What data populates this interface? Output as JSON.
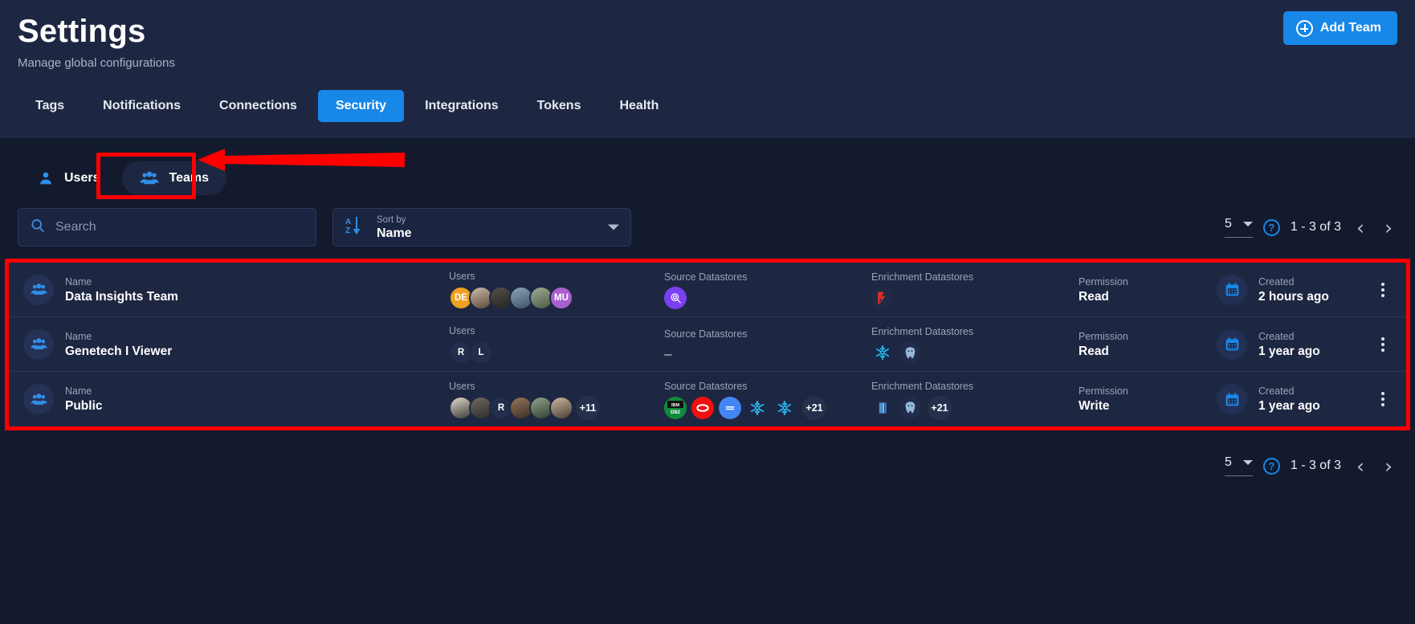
{
  "header": {
    "title": "Settings",
    "subtitle": "Manage global configurations",
    "add_team_label": "Add Team",
    "tabs": [
      {
        "label": "Tags",
        "active": false
      },
      {
        "label": "Notifications",
        "active": false
      },
      {
        "label": "Connections",
        "active": false
      },
      {
        "label": "Security",
        "active": true
      },
      {
        "label": "Integrations",
        "active": false
      },
      {
        "label": "Tokens",
        "active": false
      },
      {
        "label": "Health",
        "active": false
      }
    ]
  },
  "subnav": [
    {
      "label": "Users",
      "icon": "user-icon",
      "active": false
    },
    {
      "label": "Teams",
      "icon": "users-group-icon",
      "active": true
    }
  ],
  "filters": {
    "search_placeholder": "Search",
    "search_value": "",
    "sort_caption": "Sort by",
    "sort_value": "Name"
  },
  "pagination": {
    "page_size": "5",
    "range": "1 - 3 of 3",
    "prev_label": "‹",
    "next_label": "›"
  },
  "columns": {
    "name": "Name",
    "users": "Users",
    "source_datastores": "Source Datastores",
    "enrichment_datastores": "Enrichment Datastores",
    "permission": "Permission",
    "created": "Created"
  },
  "colors": {
    "accent": "#1787e8",
    "annotation": "#ff0000",
    "panel": "#1e2742",
    "background": "#131a2e"
  },
  "rows": [
    {
      "name": "Data Insights Team",
      "users": [
        {
          "type": "initials",
          "text": "DE",
          "color": "#f0a020"
        },
        {
          "type": "photo",
          "color": "#c9b6a4"
        },
        {
          "type": "photo",
          "color": "#3b3a38"
        },
        {
          "type": "photo",
          "color": "#6f8aa0"
        },
        {
          "type": "photo",
          "color": "#8a9c8e"
        },
        {
          "type": "initials",
          "text": "MU",
          "color": "#a95fd0"
        }
      ],
      "users_more": "",
      "source": [
        {
          "type": "icon",
          "name": "datastore-purple-icon",
          "color": "#7b3ff2"
        }
      ],
      "source_more": "",
      "source_empty": false,
      "enrichment": [
        {
          "type": "icon",
          "name": "datastore-red-icon",
          "color": "#e02b20"
        }
      ],
      "enrichment_more": "",
      "permission": "Read",
      "created": "2 hours ago"
    },
    {
      "name": "Genetech I Viewer",
      "users": [
        {
          "type": "initials",
          "text": "R",
          "color": "#232d4c"
        },
        {
          "type": "initials",
          "text": "L",
          "color": "#232d4c"
        }
      ],
      "users_more": "",
      "source": [],
      "source_more": "",
      "source_empty": true,
      "source_dash": "–",
      "enrichment": [
        {
          "type": "icon",
          "name": "snowflake-icon",
          "color": "#29b5e8"
        },
        {
          "type": "icon",
          "name": "postgresql-icon",
          "color": "#6d9dc5"
        }
      ],
      "enrichment_more": "",
      "permission": "Read",
      "created": "1 year ago"
    },
    {
      "name": "Public",
      "users": [
        {
          "type": "photo",
          "color": "#d8cfc0"
        },
        {
          "type": "photo",
          "color": "#5c5a57"
        },
        {
          "type": "initials",
          "text": "R",
          "color": "#232d4c"
        },
        {
          "type": "photo",
          "color": "#7a6250"
        },
        {
          "type": "photo",
          "color": "#7e8c76"
        },
        {
          "type": "photo",
          "color": "#b9a48e"
        }
      ],
      "users_more": "+11",
      "source": [
        {
          "type": "icon",
          "name": "ibm-db2-icon",
          "color": "#0f8a3c"
        },
        {
          "type": "icon",
          "name": "oracle-icon",
          "color": "#f20f0f"
        },
        {
          "type": "icon",
          "name": "google-bigquery-icon",
          "color": "#4285f4"
        },
        {
          "type": "icon",
          "name": "snowflake-icon",
          "color": "#29b5e8"
        },
        {
          "type": "icon",
          "name": "snowflake-icon",
          "color": "#29b5e8"
        }
      ],
      "source_more": "+21",
      "source_empty": false,
      "enrichment": [
        {
          "type": "icon",
          "name": "redshift-icon",
          "color": "#4a90d9"
        },
        {
          "type": "icon",
          "name": "postgresql-icon",
          "color": "#6d9dc5"
        }
      ],
      "enrichment_more": "+21",
      "permission": "Write",
      "created": "1 year ago"
    }
  ]
}
